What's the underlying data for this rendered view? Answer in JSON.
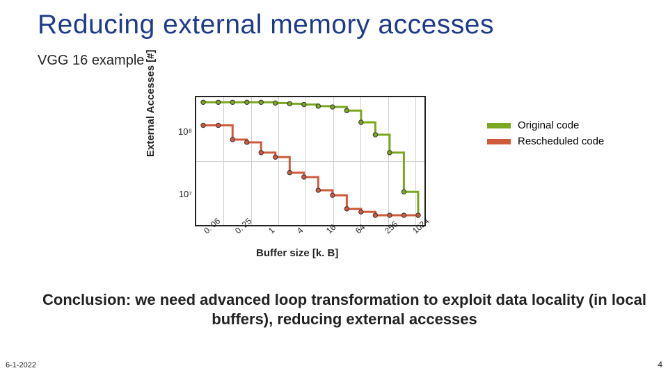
{
  "title": "Reducing external memory accesses",
  "subtitle": "VGG 16 example",
  "axes": {
    "ylabel": "External Accesses [#]",
    "xlabel": "Buffer size [k. B]"
  },
  "yticks": [
    "10⁷",
    "10⁸"
  ],
  "xticks": [
    "0. 06",
    "0. 25",
    "1",
    "4",
    "16",
    "64",
    "256",
    "1024"
  ],
  "legend": {
    "original": {
      "label": "Original code",
      "color": "#7aa720"
    },
    "rescheduled": {
      "label": "Rescheduled code",
      "color": "#cf5a3c"
    }
  },
  "conclusion": "Conclusion: we need advanced loop transformation to exploit data locality (in local buffers), reducing external accesses",
  "date": "6-1-2022",
  "pagenum": "4",
  "chart_data": {
    "type": "line",
    "x": [
      0.06,
      0.125,
      0.25,
      0.5,
      1,
      2,
      4,
      8,
      16,
      32,
      64,
      128,
      256,
      512,
      1024,
      2048
    ],
    "xscale": "log2",
    "yscale": "log10",
    "ylim": [
      6000000,
      500000000
    ],
    "xlim": [
      0.04,
      2600
    ],
    "series": [
      {
        "name": "Original code",
        "color": "#7aa720",
        "values": [
          400000000,
          400000000,
          400000000,
          400000000,
          400000000,
          390000000,
          380000000,
          370000000,
          350000000,
          340000000,
          300000000,
          200000000,
          130000000,
          70000000,
          18000000,
          8000000
        ]
      },
      {
        "name": "Rescheduled code",
        "color": "#cf5a3c",
        "values": [
          180000000,
          180000000,
          110000000,
          100000000,
          70000000,
          60000000,
          35000000,
          30000000,
          19000000,
          16000000,
          10000000,
          9000000,
          8000000,
          8000000,
          8000000,
          8000000
        ]
      }
    ]
  }
}
